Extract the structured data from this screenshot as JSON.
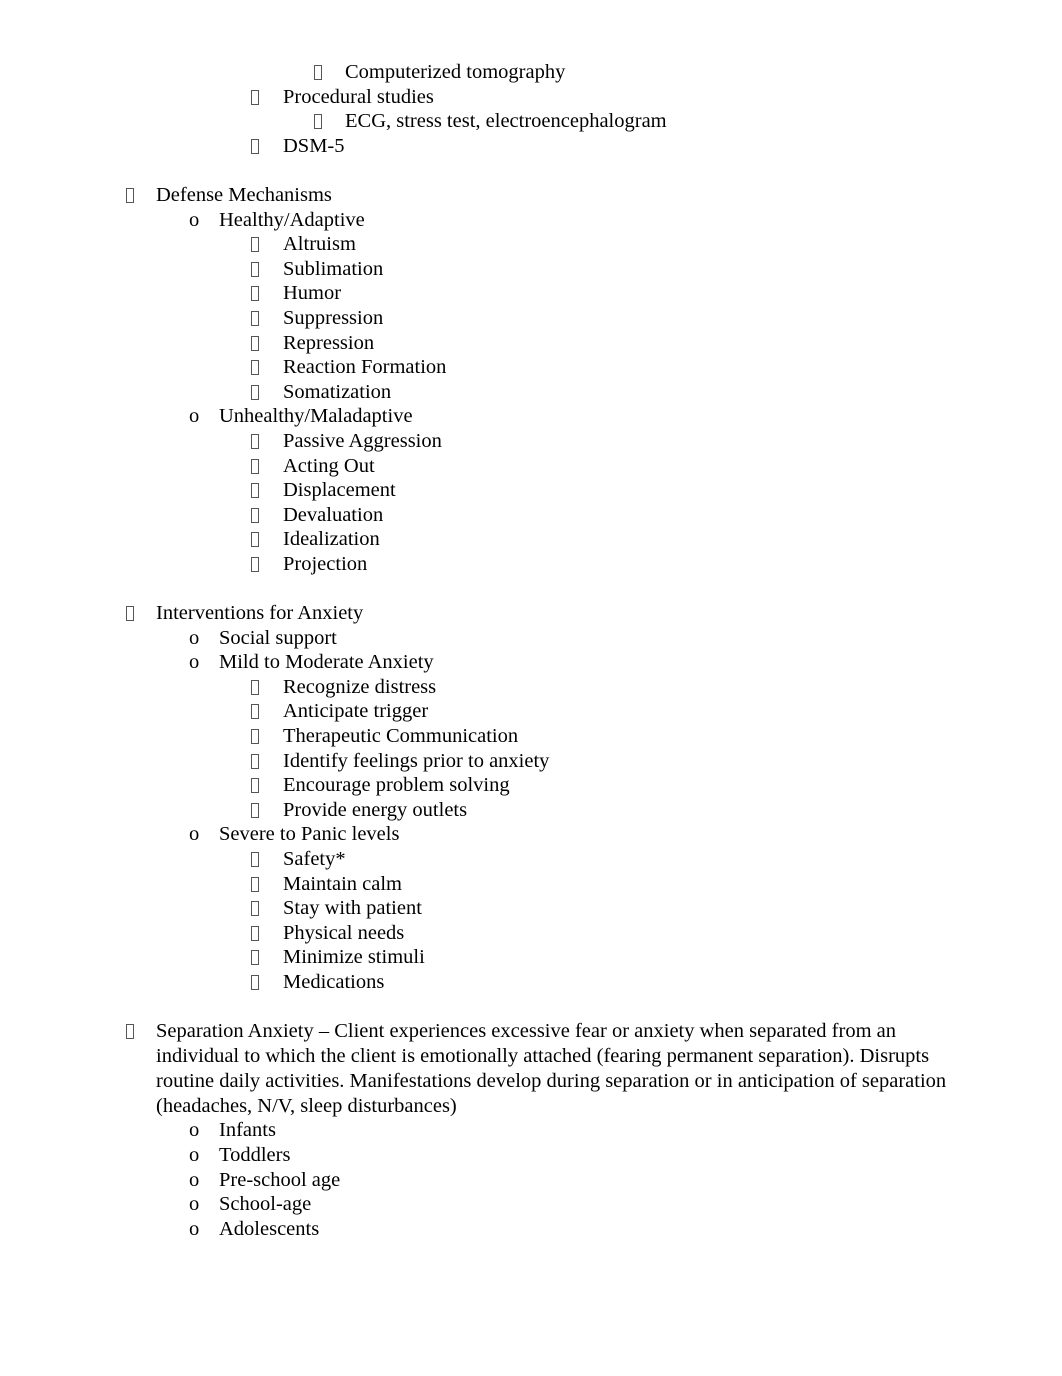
{
  "page": {
    "background": "#ffffff",
    "text_color": "#000000",
    "bullet_outline_color": "#55565a"
  },
  "bullets": {
    "box": "missing-glyph-box",
    "circle": "o"
  },
  "outline": [
    {
      "level": 4,
      "bullet": "box",
      "text": "Computerized tomography"
    },
    {
      "level": 3,
      "bullet": "box",
      "text": "Procedural studies"
    },
    {
      "level": 4,
      "bullet": "box",
      "text": "ECG, stress test, electroencephalogram"
    },
    {
      "level": 3,
      "bullet": "box",
      "text": "DSM-5"
    },
    {
      "level": 0,
      "bullet": "none",
      "text": ""
    },
    {
      "level": 1,
      "bullet": "box",
      "text": "Defense Mechanisms"
    },
    {
      "level": 2,
      "bullet": "circle",
      "text": "Healthy/Adaptive"
    },
    {
      "level": 3,
      "bullet": "box",
      "text": "Altruism"
    },
    {
      "level": 3,
      "bullet": "box",
      "text": "Sublimation"
    },
    {
      "level": 3,
      "bullet": "box",
      "text": "Humor"
    },
    {
      "level": 3,
      "bullet": "box",
      "text": "Suppression"
    },
    {
      "level": 3,
      "bullet": "box",
      "text": "Repression"
    },
    {
      "level": 3,
      "bullet": "box",
      "text": "Reaction Formation"
    },
    {
      "level": 3,
      "bullet": "box",
      "text": "Somatization"
    },
    {
      "level": 2,
      "bullet": "circle",
      "text": "Unhealthy/Maladaptive"
    },
    {
      "level": 3,
      "bullet": "box",
      "text": "Passive Aggression"
    },
    {
      "level": 3,
      "bullet": "box",
      "text": "Acting Out"
    },
    {
      "level": 3,
      "bullet": "box",
      "text": "Displacement"
    },
    {
      "level": 3,
      "bullet": "box",
      "text": "Devaluation"
    },
    {
      "level": 3,
      "bullet": "box",
      "text": "Idealization"
    },
    {
      "level": 3,
      "bullet": "box",
      "text": "Projection"
    },
    {
      "level": 0,
      "bullet": "none",
      "text": ""
    },
    {
      "level": 1,
      "bullet": "box",
      "text": "Interventions for Anxiety"
    },
    {
      "level": 2,
      "bullet": "circle",
      "text": "Social support"
    },
    {
      "level": 2,
      "bullet": "circle",
      "text": "Mild to Moderate Anxiety"
    },
    {
      "level": 3,
      "bullet": "box",
      "text": "Recognize distress"
    },
    {
      "level": 3,
      "bullet": "box",
      "text": "Anticipate trigger"
    },
    {
      "level": 3,
      "bullet": "box",
      "text": "Therapeutic Communication"
    },
    {
      "level": 3,
      "bullet": "box",
      "text": "Identify feelings prior to anxiety"
    },
    {
      "level": 3,
      "bullet": "box",
      "text": "Encourage problem solving"
    },
    {
      "level": 3,
      "bullet": "box",
      "text": "Provide energy outlets"
    },
    {
      "level": 2,
      "bullet": "circle",
      "text": "Severe to Panic levels"
    },
    {
      "level": 3,
      "bullet": "box",
      "text": "Safety*"
    },
    {
      "level": 3,
      "bullet": "box",
      "text": "Maintain calm"
    },
    {
      "level": 3,
      "bullet": "box",
      "text": "Stay with patient"
    },
    {
      "level": 3,
      "bullet": "box",
      "text": "Physical needs"
    },
    {
      "level": 3,
      "bullet": "box",
      "text": "Minimize stimuli"
    },
    {
      "level": 3,
      "bullet": "box",
      "text": "Medications"
    },
    {
      "level": 0,
      "bullet": "none",
      "text": ""
    },
    {
      "level": 1,
      "bullet": "box",
      "wrap": true,
      "text": "Separation Anxiety – Client experiences excessive fear or anxiety when separated from an individual to which the client is emotionally attached (fearing permanent separation). Disrupts routine daily activities. Manifestations develop during separation or in anticipation of separation (headaches, N/V, sleep disturbances)"
    },
    {
      "level": 2,
      "bullet": "circle",
      "text": "Infants"
    },
    {
      "level": 2,
      "bullet": "circle",
      "text": "Toddlers"
    },
    {
      "level": 2,
      "bullet": "circle",
      "text": "Pre-school age"
    },
    {
      "level": 2,
      "bullet": "circle",
      "text": "School-age"
    },
    {
      "level": 2,
      "bullet": "circle",
      "text": "Adolescents"
    }
  ]
}
